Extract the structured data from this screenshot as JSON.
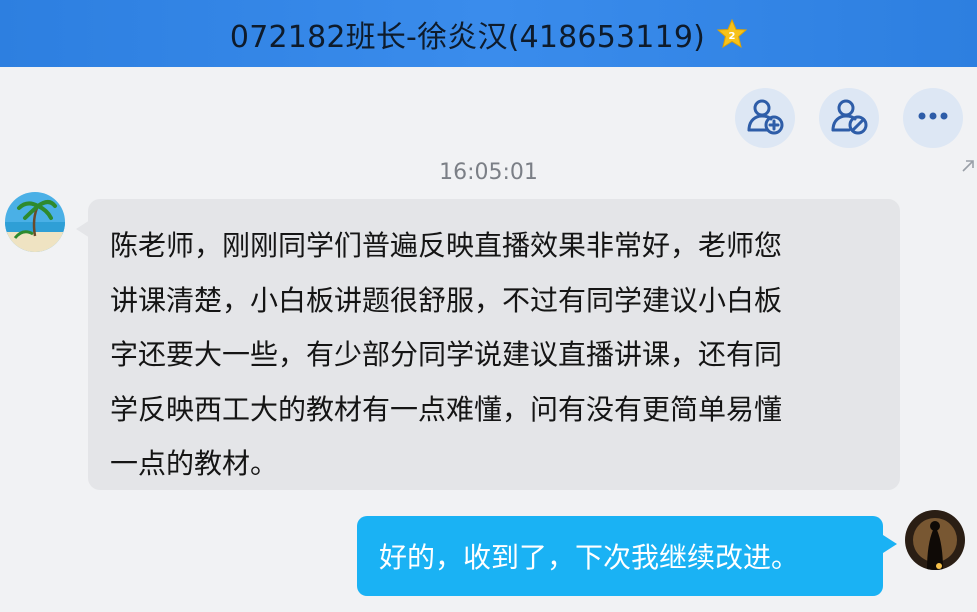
{
  "window": {
    "title": "072182班长-徐炎汉(418653119)",
    "vip_icon": "gold-star-badge-icon",
    "titlebar_color": "#2d7fe0"
  },
  "actions": [
    {
      "name": "add-contact",
      "icon": "add-person-icon"
    },
    {
      "name": "share-contact",
      "icon": "person-share-icon"
    },
    {
      "name": "more",
      "icon": "more-horizontal-icon"
    }
  ],
  "chat": {
    "timestamp": "16:05:01",
    "messages": [
      {
        "direction": "incoming",
        "avatar": "beach-palm-avatar",
        "lines": [
          "陈老师，刚刚同学们普遍反映直播效果非常好，老师您",
          "讲课清楚，小白板讲题很舒服，不过有同学建议小白板",
          "字还要大一些，有少部分同学说建议直播讲课，还有同",
          "学反映西工大的教材有一点难懂，问有没有更简单易懂",
          "一点的教材。"
        ]
      },
      {
        "direction": "outgoing",
        "avatar": "dark-silhouette-avatar",
        "text": "好的，收到了，下次我继续改进。",
        "bubble_color": "#1ab2f4"
      }
    ]
  }
}
